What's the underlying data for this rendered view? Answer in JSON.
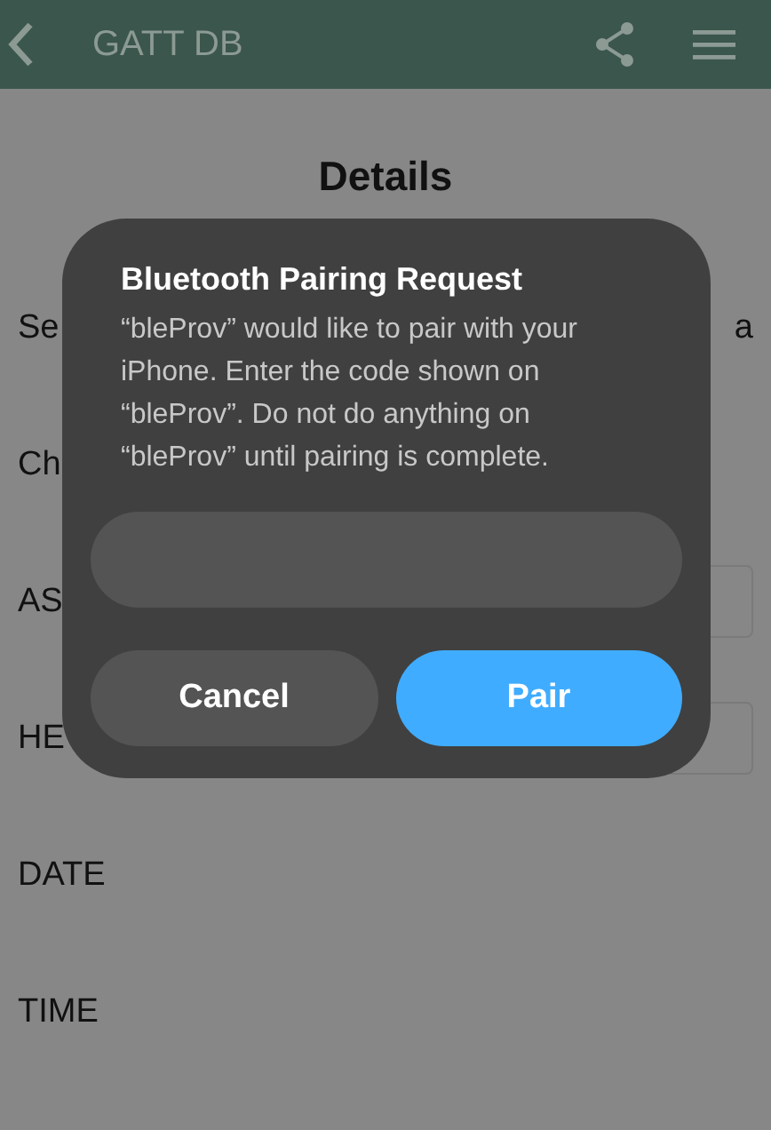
{
  "header": {
    "title": "GATT DB"
  },
  "page": {
    "title": "Details",
    "rows": [
      {
        "kind": "text",
        "label": "Se",
        "value": "a"
      },
      {
        "kind": "text",
        "label": "Ch"
      },
      {
        "kind": "field",
        "label": "AS"
      },
      {
        "kind": "field",
        "label": "HE"
      },
      {
        "kind": "text",
        "label": "DATE"
      },
      {
        "kind": "text",
        "label": "TIME"
      }
    ]
  },
  "dialog": {
    "title": "Bluetooth Pairing Request",
    "message": "“bleProv” would like to pair with your iPhone. Enter the code shown on “bleProv”. Do not do anything on “bleProv” until pairing is complete.",
    "buttons": [
      {
        "label": "Cancel",
        "kind": "secondary"
      },
      {
        "label": "Pair",
        "kind": "primary"
      }
    ]
  }
}
